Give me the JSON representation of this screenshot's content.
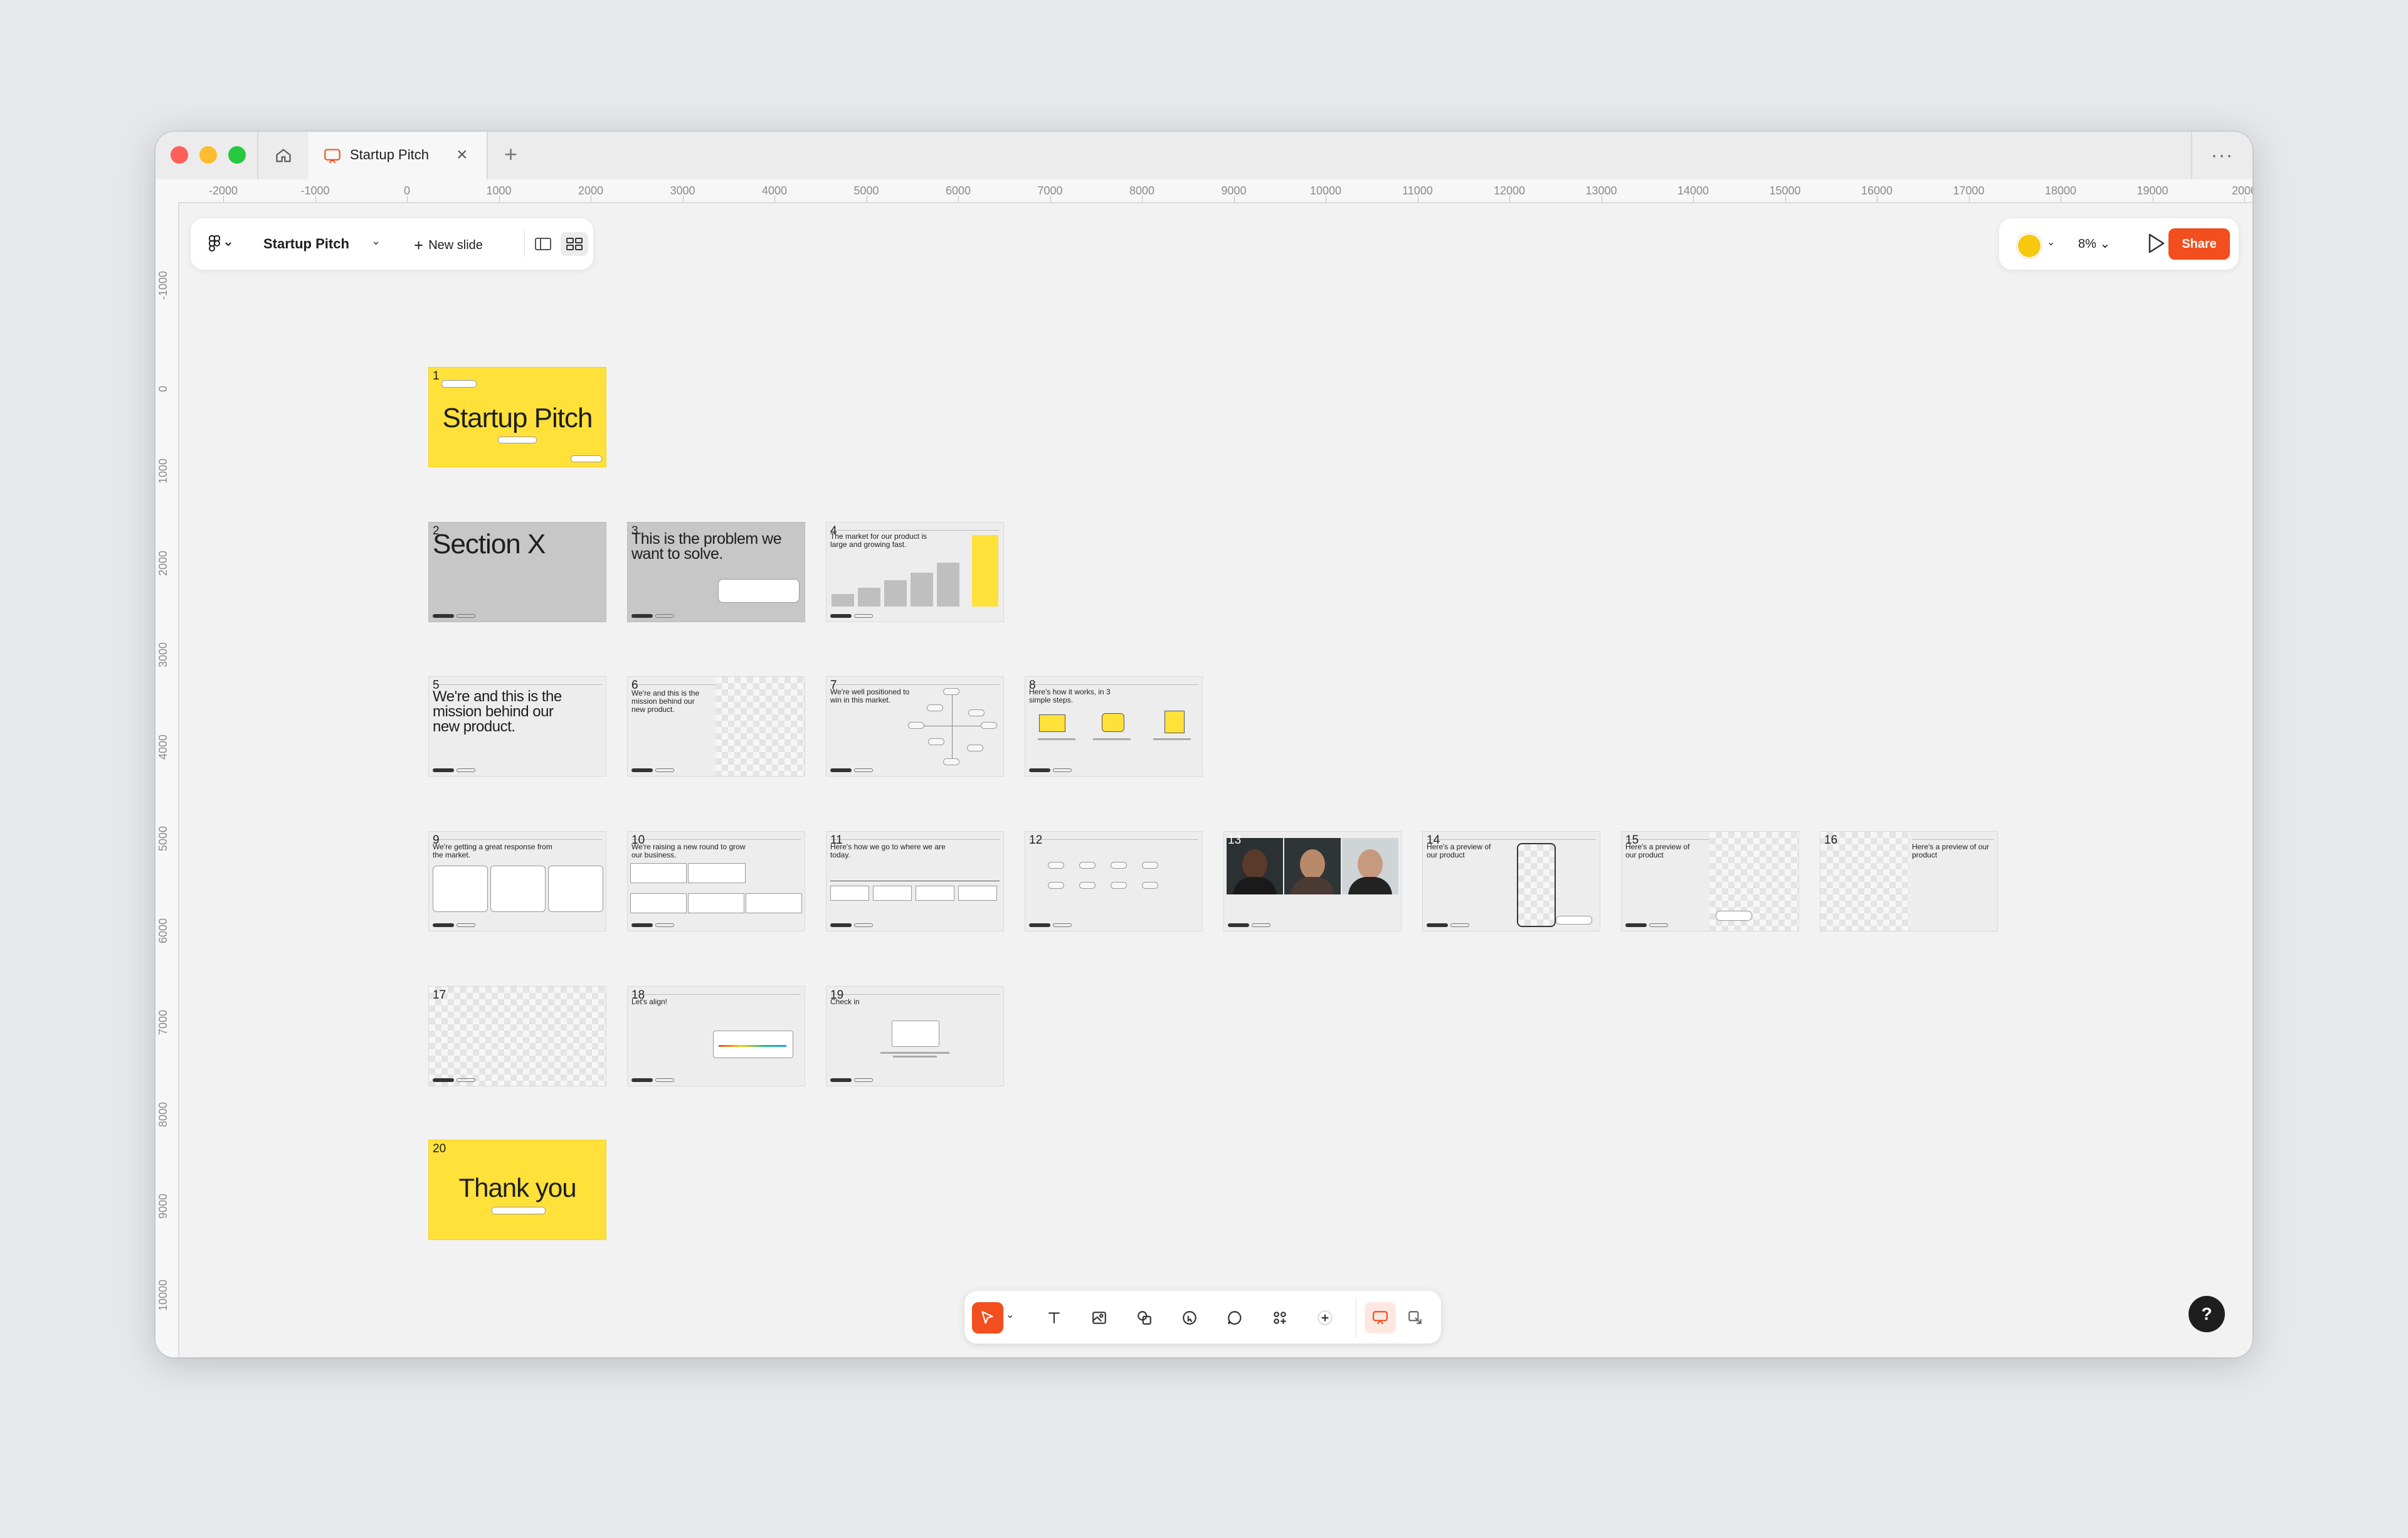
{
  "window": {
    "tab_title": "Startup Pitch",
    "new_tab": "+",
    "more": "···"
  },
  "ruler": {
    "top": [
      "-2000",
      "-1000",
      "0",
      "1000",
      "2000",
      "3000",
      "4000",
      "5000",
      "6000",
      "7000",
      "8000",
      "9000",
      "10000",
      "11000",
      "12000",
      "13000",
      "14000",
      "15000",
      "16000",
      "17000",
      "18000",
      "19000",
      "2000"
    ],
    "left": [
      "-1000",
      "0",
      "1000",
      "2000",
      "3000",
      "4000",
      "5000",
      "6000",
      "7000",
      "8000",
      "9000",
      "10000",
      "00"
    ]
  },
  "toolbar_top": {
    "doc_name": "Startup Pitch",
    "new_slide": "New slide"
  },
  "toolbar_right": {
    "zoom": "8%",
    "share": "Share"
  },
  "slides": {
    "s1": {
      "num": "1",
      "title": "Startup Pitch"
    },
    "s2": {
      "num": "2",
      "title": "Section X"
    },
    "s3": {
      "num": "3",
      "title": "This is the problem we want to solve."
    },
    "s4": {
      "num": "4",
      "title": "The market for our product is large and growing fast."
    },
    "s5": {
      "num": "5",
      "title": "We're and this is the mission behind our new product."
    },
    "s6": {
      "num": "6",
      "title": "We're and this is the mission behind our new product."
    },
    "s7": {
      "num": "7",
      "title": "We're well positioned to win in this market."
    },
    "s8": {
      "num": "8",
      "title": "Here's how it works, in 3 simple steps."
    },
    "s9": {
      "num": "9",
      "title": "We're getting a great response from the market."
    },
    "s10": {
      "num": "10",
      "title": "We're raising a new round to grow our business."
    },
    "s11": {
      "num": "11",
      "title": "Here's how we go to where we are today."
    },
    "s12": {
      "num": "12"
    },
    "s13": {
      "num": "13"
    },
    "s14": {
      "num": "14",
      "title": "Here's a preview of our product"
    },
    "s15": {
      "num": "15",
      "title": "Here's a preview of our product"
    },
    "s16": {
      "num": "16",
      "title": "Here's a preview of our product"
    },
    "s17": {
      "num": "17"
    },
    "s18": {
      "num": "18",
      "title": "Let's align!"
    },
    "s19": {
      "num": "19",
      "title": "Check in"
    },
    "s20": {
      "num": "20",
      "title": "Thank you"
    }
  },
  "help": "?",
  "colors": {
    "accent": "#f24e1e",
    "slide_yellow": "#ffe13a",
    "slide_gray": "#c7c7c7"
  }
}
